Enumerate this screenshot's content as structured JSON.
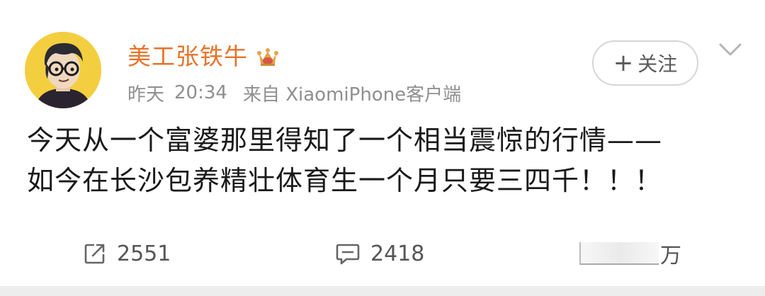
{
  "post": {
    "author": {
      "name": "美工张铁牛",
      "avatar_icon": "cartoon-man-glasses-avatar",
      "badge_icon": "vip-crown-icon"
    },
    "time": {
      "day": "昨天",
      "clock": "20:34"
    },
    "source": "来自 XiaomiPhone客户端",
    "follow_button": {
      "plus": "+",
      "label": "关注"
    },
    "content_lines": [
      "今天从一个富婆那里得知了一个相当震惊的行情——",
      "如今在长沙包养精壮体育生一个月只要三四千！！！"
    ],
    "actions": {
      "repost_count": "2551",
      "comment_count": "2418",
      "like_suffix": "万"
    }
  },
  "colors": {
    "username": "#e7732a",
    "meta": "#8f8f8f",
    "body_text": "#1a1a1a",
    "avatar_bg": "#f3cf3f",
    "page_bg": "#ededed"
  }
}
